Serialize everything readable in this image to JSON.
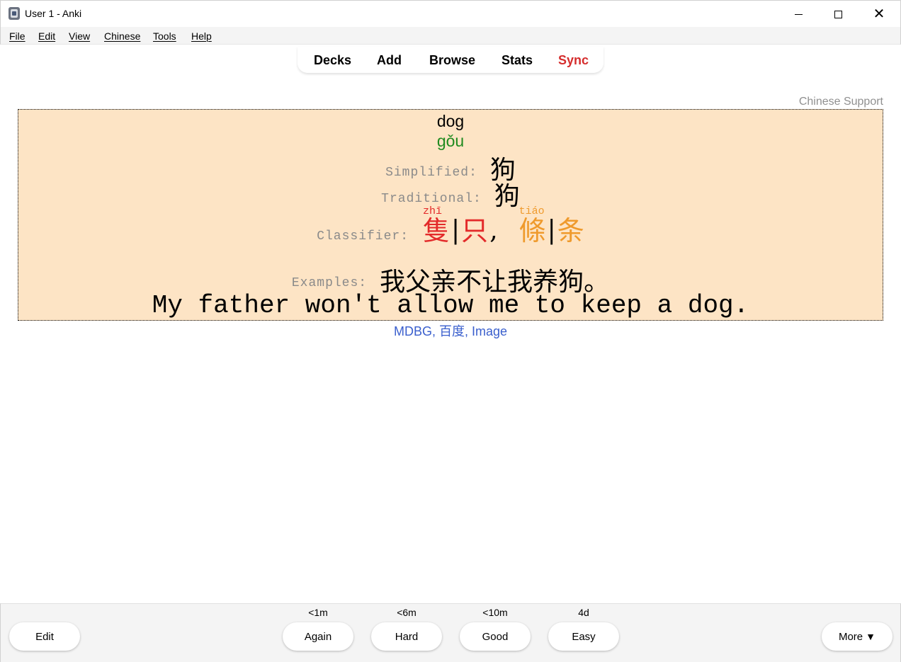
{
  "window": {
    "title": "User 1 - Anki",
    "minimize": "",
    "maximize": "",
    "close": "✕"
  },
  "menu": [
    "File",
    "Edit",
    "View",
    "Chinese",
    "Tools",
    "Help"
  ],
  "toolbar": {
    "decks": "Decks",
    "add": "Add",
    "browse": "Browse",
    "stats": "Stats",
    "sync": "Sync"
  },
  "card": {
    "support_label": "Chinese Support",
    "word": "dog",
    "pinyin": "gǒu",
    "simplified_label": "Simplified:",
    "simplified": "狗",
    "traditional_label": "Traditional:",
    "traditional": "狗",
    "classifier_label": "Classifier:",
    "classifiers": [
      {
        "pinyin": "zhī",
        "traditional": "隻",
        "simplified": "只",
        "color": "#e32a2a"
      },
      {
        "pinyin": "tiáo",
        "traditional": "條",
        "simplified": "条",
        "color": "#ef9a2c"
      }
    ],
    "classifier_separator": "|",
    "classifier_comma": ",",
    "examples_label": "Examples:",
    "example_cn": "我父亲不让我养狗。",
    "example_en": "My father won't allow me to keep a dog.",
    "links": {
      "mdbg": "MDBG",
      "baidu": "百度",
      "image": "Image",
      "separator": ", "
    }
  },
  "bottom": {
    "edit": "Edit",
    "answers": [
      {
        "label": "Again",
        "interval": "<1m"
      },
      {
        "label": "Hard",
        "interval": "<6m"
      },
      {
        "label": "Good",
        "interval": "<10m"
      },
      {
        "label": "Easy",
        "interval": "4d"
      }
    ],
    "more": "More",
    "more_arrow": "▼"
  },
  "colors": {
    "card_bg": "#fde4c5",
    "sync": "#d52d2d",
    "pinyin": "#1f8a1f",
    "link": "#3a5fcd"
  }
}
